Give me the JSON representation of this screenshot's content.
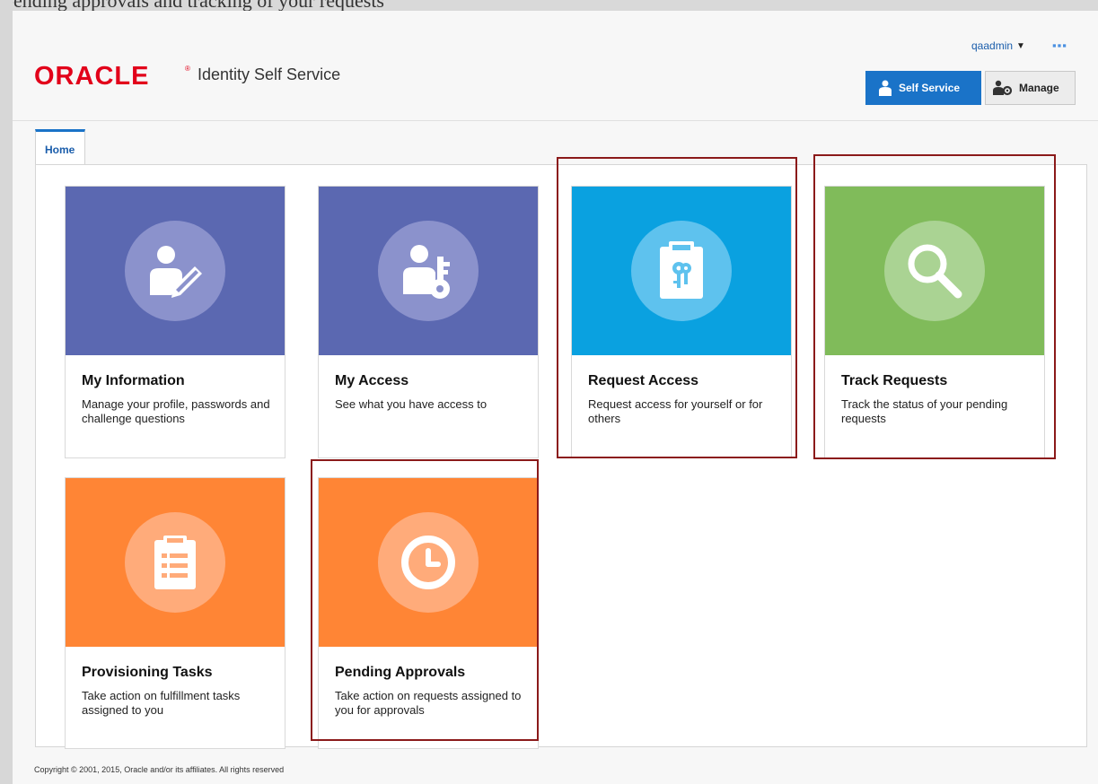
{
  "top_strip_text": "pending approvals and tracking of your requests",
  "brand": {
    "logo": "ORACLE",
    "product": "Identity Self Service"
  },
  "user": {
    "name": "qaadmin",
    "caret": "▼",
    "more": "▪▪▪"
  },
  "header_buttons": {
    "self_service": "Self Service",
    "manage": "Manage"
  },
  "tabs": [
    {
      "label": "Home"
    }
  ],
  "tiles": [
    {
      "title": "My Information",
      "description": "Manage your profile, passwords and challenge questions",
      "color": "#5b68b1",
      "circle": "#8b92cc",
      "icon": "user-edit-icon"
    },
    {
      "title": "My Access",
      "description": "See what you have access to",
      "color": "#5b68b1",
      "circle": "#8b92cc",
      "icon": "user-key-icon"
    },
    {
      "title": "Request Access",
      "description": "Request access for yourself or for others",
      "color": "#0aa1e0",
      "circle": "#5ec2ee",
      "icon": "clipboard-key-icon"
    },
    {
      "title": "Track Requests",
      "description": "Track the status of your pending requests",
      "color": "#80bb5a",
      "circle": "#aad393",
      "icon": "search-icon"
    },
    {
      "title": "Provisioning Tasks",
      "description": "Take action on fulfillment tasks assigned to you",
      "color": "#ff8535",
      "circle": "#ffab7a",
      "icon": "task-list-icon"
    },
    {
      "title": "Pending Approvals",
      "description": "Take action on requests assigned to you for approvals",
      "color": "#ff8535",
      "circle": "#ffab7a",
      "icon": "clock-icon"
    }
  ],
  "footer": {
    "copyright": "Copyright © 2001, 2015, Oracle and/or its affiliates. All rights reserved"
  }
}
